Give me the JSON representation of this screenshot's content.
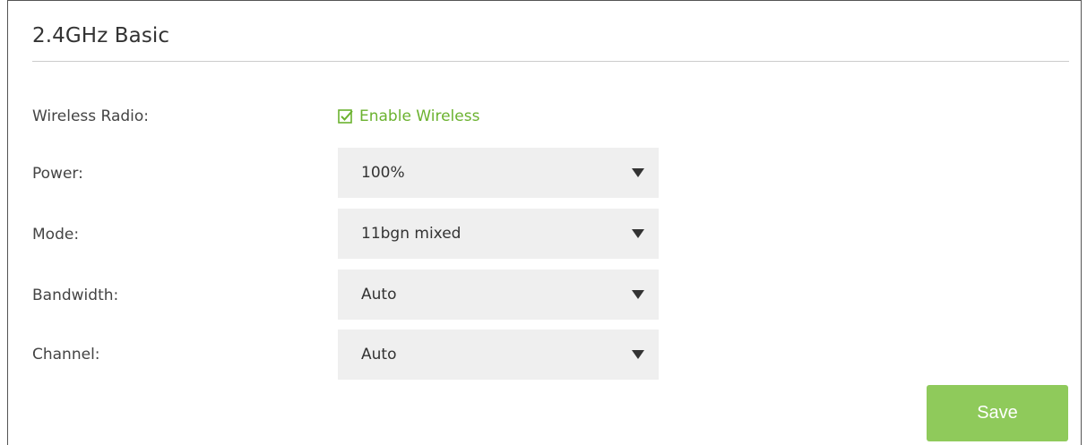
{
  "section": {
    "title": "2.4GHz Basic"
  },
  "wireless_radio": {
    "label": "Wireless Radio:",
    "checkbox_label": "Enable Wireless",
    "checked": true
  },
  "power": {
    "label": "Power:",
    "selected": "100%"
  },
  "mode": {
    "label": "Mode:",
    "selected": "11bgn mixed"
  },
  "bandwidth": {
    "label": "Bandwidth:",
    "selected": "Auto"
  },
  "channel": {
    "label": "Channel:",
    "selected": "Auto"
  },
  "actions": {
    "save_label": "Save"
  },
  "icons": {
    "checkbox": "checkbox-checked-icon",
    "dropdown": "chevron-down-icon"
  },
  "colors": {
    "accent_green": "#6bb22f",
    "button_green": "#8fca5b",
    "select_bg": "#efefef",
    "divider": "#cccccc"
  }
}
